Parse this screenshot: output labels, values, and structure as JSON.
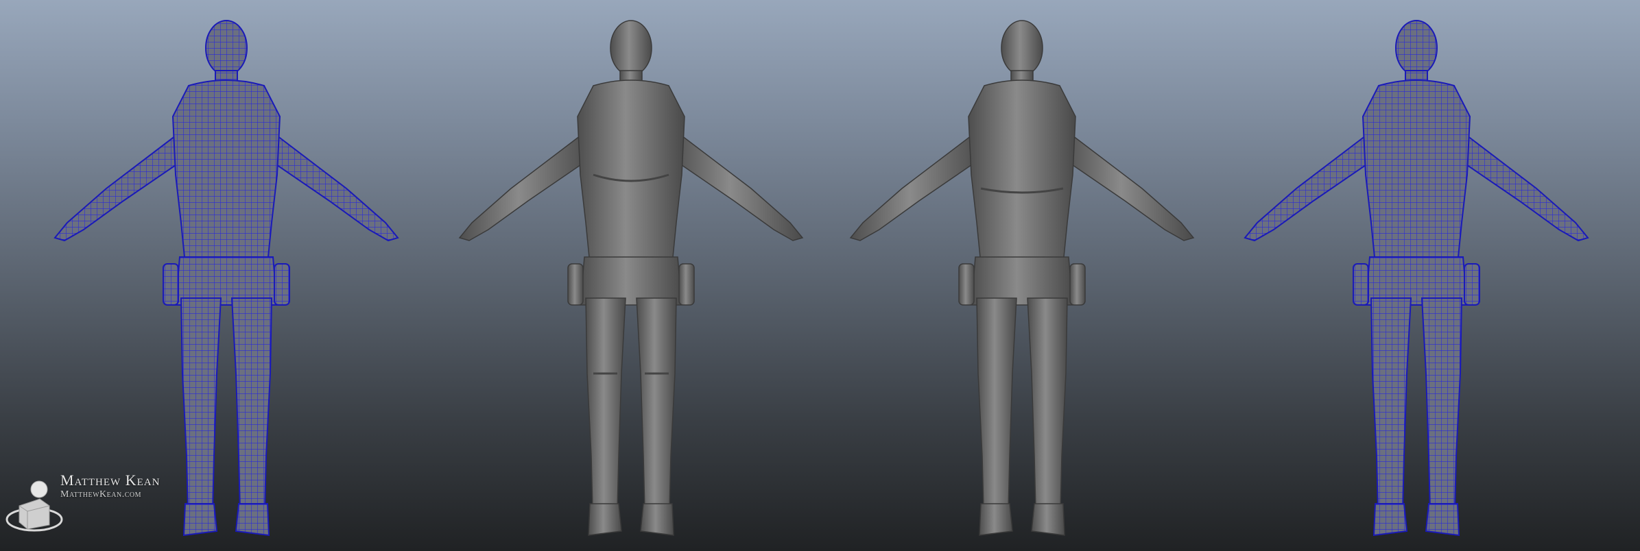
{
  "brand": {
    "name": "Matthew Kean",
    "url": "MatthewKean.com"
  },
  "views": [
    {
      "name": "front-wireframe",
      "render": "wireframe",
      "facing": "front"
    },
    {
      "name": "front-shaded",
      "render": "shaded",
      "facing": "front"
    },
    {
      "name": "back-shaded",
      "render": "shaded",
      "facing": "back"
    },
    {
      "name": "back-wireframe",
      "render": "wireframe",
      "facing": "back"
    }
  ],
  "colors": {
    "background_top": "#98a7bb",
    "background_bottom": "#202224",
    "wireframe_line": "#2a2ad8",
    "wireframe_fill": "#6b7080",
    "shaded_body": "#6f6f6f",
    "brand_text": "#e7e7e7"
  },
  "icons": [
    "logo-icon"
  ]
}
